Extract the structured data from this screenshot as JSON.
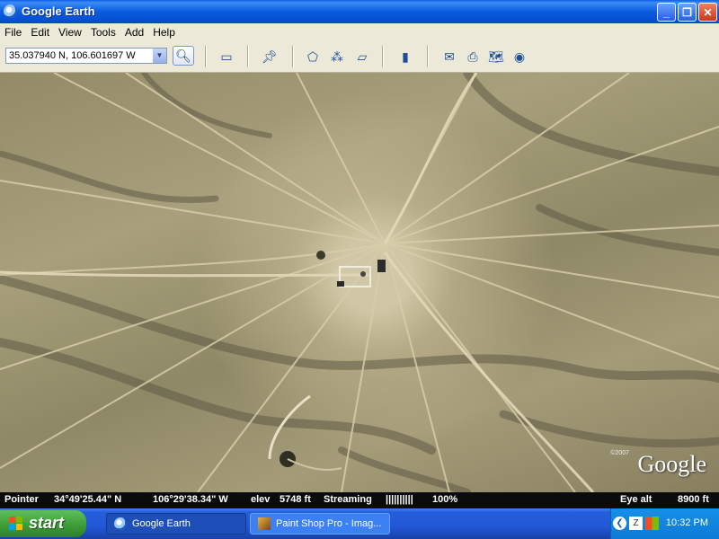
{
  "window": {
    "title": "Google Earth"
  },
  "menu": [
    "File",
    "Edit",
    "View",
    "Tools",
    "Add",
    "Help"
  ],
  "toolbar": {
    "search_value": "35.037940 N, 106.601697 W"
  },
  "statusbar": {
    "pointer_label": "Pointer",
    "pointer_lat": "34°49'25.44\" N",
    "pointer_lon": "106°29'38.34\" W",
    "elev_label": "elev",
    "elev_value": "5748 ft",
    "streaming_label": "Streaming",
    "streaming_bar": "||||||||||",
    "streaming_pct": "100%",
    "eye_alt_label": "Eye alt",
    "eye_alt_value": "8900 ft"
  },
  "map": {
    "logo": "Google",
    "copyright": "©2007"
  },
  "taskbar": {
    "start_label": "start",
    "tasks": [
      {
        "label": "Google Earth",
        "active": true
      },
      {
        "label": "Paint Shop Pro - Imag...",
        "active": false
      }
    ],
    "clock": "10:32 PM"
  },
  "colors": {
    "taskbar": "#245edb",
    "start": "#3c9a36",
    "titlebar": "#0b5ce0"
  }
}
